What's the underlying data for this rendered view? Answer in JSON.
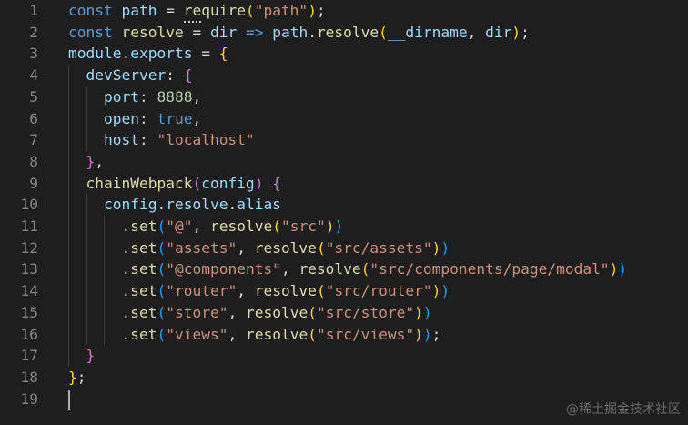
{
  "editor": {
    "line_numbers": [
      "1",
      "2",
      "3",
      "4",
      "5",
      "6",
      "7",
      "8",
      "9",
      "10",
      "11",
      "12",
      "13",
      "14",
      "15",
      "16",
      "17",
      "18",
      "19"
    ],
    "lines": [
      [
        {
          "t": "const ",
          "c": "kw"
        },
        {
          "t": "path",
          "c": "var"
        },
        {
          "t": " = ",
          "c": "op"
        },
        {
          "t": "require",
          "c": "fn"
        },
        {
          "t": "(",
          "c": "b1"
        },
        {
          "t": "\"path\"",
          "c": "str"
        },
        {
          "t": ")",
          "c": "b1"
        },
        {
          "t": ";",
          "c": "op"
        }
      ],
      [
        {
          "t": "const ",
          "c": "kw"
        },
        {
          "t": "resolve",
          "c": "fn"
        },
        {
          "t": " = ",
          "c": "op"
        },
        {
          "t": "dir",
          "c": "var"
        },
        {
          "t": " => ",
          "c": "kw"
        },
        {
          "t": "path",
          "c": "var"
        },
        {
          "t": ".",
          "c": "op"
        },
        {
          "t": "resolve",
          "c": "fn"
        },
        {
          "t": "(",
          "c": "b1"
        },
        {
          "t": "__dirname",
          "c": "var"
        },
        {
          "t": ", ",
          "c": "op"
        },
        {
          "t": "dir",
          "c": "var"
        },
        {
          "t": ")",
          "c": "b1"
        },
        {
          "t": ";",
          "c": "op"
        }
      ],
      [
        {
          "t": "module",
          "c": "var"
        },
        {
          "t": ".",
          "c": "op"
        },
        {
          "t": "exports",
          "c": "var"
        },
        {
          "t": " = ",
          "c": "op"
        },
        {
          "t": "{",
          "c": "b1"
        }
      ],
      [
        {
          "t": "  ",
          "c": "op"
        },
        {
          "t": "devServer",
          "c": "var"
        },
        {
          "t": ": ",
          "c": "op"
        },
        {
          "t": "{",
          "c": "b2"
        }
      ],
      [
        {
          "t": "    ",
          "c": "op"
        },
        {
          "t": "port",
          "c": "var"
        },
        {
          "t": ": ",
          "c": "op"
        },
        {
          "t": "8888",
          "c": "num"
        },
        {
          "t": ",",
          "c": "op"
        }
      ],
      [
        {
          "t": "    ",
          "c": "op"
        },
        {
          "t": "open",
          "c": "var"
        },
        {
          "t": ": ",
          "c": "op"
        },
        {
          "t": "true",
          "c": "kw"
        },
        {
          "t": ",",
          "c": "op"
        }
      ],
      [
        {
          "t": "    ",
          "c": "op"
        },
        {
          "t": "host",
          "c": "var"
        },
        {
          "t": ": ",
          "c": "op"
        },
        {
          "t": "\"localhost\"",
          "c": "str"
        }
      ],
      [
        {
          "t": "  ",
          "c": "op"
        },
        {
          "t": "}",
          "c": "b2"
        },
        {
          "t": ",",
          "c": "op"
        }
      ],
      [
        {
          "t": "  ",
          "c": "op"
        },
        {
          "t": "chainWebpack",
          "c": "fn"
        },
        {
          "t": "(",
          "c": "b2"
        },
        {
          "t": "config",
          "c": "var"
        },
        {
          "t": ")",
          "c": "b2"
        },
        {
          "t": " ",
          "c": "op"
        },
        {
          "t": "{",
          "c": "b2"
        }
      ],
      [
        {
          "t": "    ",
          "c": "op"
        },
        {
          "t": "config",
          "c": "var"
        },
        {
          "t": ".",
          "c": "op"
        },
        {
          "t": "resolve",
          "c": "var"
        },
        {
          "t": ".",
          "c": "op"
        },
        {
          "t": "alias",
          "c": "var"
        }
      ],
      [
        {
          "t": "      .",
          "c": "op"
        },
        {
          "t": "set",
          "c": "fn"
        },
        {
          "t": "(",
          "c": "b3"
        },
        {
          "t": "\"@\"",
          "c": "str"
        },
        {
          "t": ", ",
          "c": "op"
        },
        {
          "t": "resolve",
          "c": "fn"
        },
        {
          "t": "(",
          "c": "b1"
        },
        {
          "t": "\"src\"",
          "c": "str"
        },
        {
          "t": ")",
          "c": "b1"
        },
        {
          "t": ")",
          "c": "b3"
        }
      ],
      [
        {
          "t": "      .",
          "c": "op"
        },
        {
          "t": "set",
          "c": "fn"
        },
        {
          "t": "(",
          "c": "b3"
        },
        {
          "t": "\"assets\"",
          "c": "str"
        },
        {
          "t": ", ",
          "c": "op"
        },
        {
          "t": "resolve",
          "c": "fn"
        },
        {
          "t": "(",
          "c": "b1"
        },
        {
          "t": "\"src/assets\"",
          "c": "str"
        },
        {
          "t": ")",
          "c": "b1"
        },
        {
          "t": ")",
          "c": "b3"
        }
      ],
      [
        {
          "t": "      .",
          "c": "op"
        },
        {
          "t": "set",
          "c": "fn"
        },
        {
          "t": "(",
          "c": "b3"
        },
        {
          "t": "\"@components\"",
          "c": "str"
        },
        {
          "t": ", ",
          "c": "op"
        },
        {
          "t": "resolve",
          "c": "fn"
        },
        {
          "t": "(",
          "c": "b1"
        },
        {
          "t": "\"src/components/page/modal\"",
          "c": "str"
        },
        {
          "t": ")",
          "c": "b1"
        },
        {
          "t": ")",
          "c": "b3"
        }
      ],
      [
        {
          "t": "      .",
          "c": "op"
        },
        {
          "t": "set",
          "c": "fn"
        },
        {
          "t": "(",
          "c": "b3"
        },
        {
          "t": "\"router\"",
          "c": "str"
        },
        {
          "t": ", ",
          "c": "op"
        },
        {
          "t": "resolve",
          "c": "fn"
        },
        {
          "t": "(",
          "c": "b1"
        },
        {
          "t": "\"src/router\"",
          "c": "str"
        },
        {
          "t": ")",
          "c": "b1"
        },
        {
          "t": ")",
          "c": "b3"
        }
      ],
      [
        {
          "t": "      .",
          "c": "op"
        },
        {
          "t": "set",
          "c": "fn"
        },
        {
          "t": "(",
          "c": "b3"
        },
        {
          "t": "\"store\"",
          "c": "str"
        },
        {
          "t": ", ",
          "c": "op"
        },
        {
          "t": "resolve",
          "c": "fn"
        },
        {
          "t": "(",
          "c": "b1"
        },
        {
          "t": "\"src/store\"",
          "c": "str"
        },
        {
          "t": ")",
          "c": "b1"
        },
        {
          "t": ")",
          "c": "b3"
        }
      ],
      [
        {
          "t": "      .",
          "c": "op"
        },
        {
          "t": "set",
          "c": "fn"
        },
        {
          "t": "(",
          "c": "b3"
        },
        {
          "t": "\"views\"",
          "c": "str"
        },
        {
          "t": ", ",
          "c": "op"
        },
        {
          "t": "resolve",
          "c": "fn"
        },
        {
          "t": "(",
          "c": "b1"
        },
        {
          "t": "\"src/views\"",
          "c": "str"
        },
        {
          "t": ")",
          "c": "b1"
        },
        {
          "t": ")",
          "c": "b3"
        },
        {
          "t": ";",
          "c": "op"
        }
      ],
      [
        {
          "t": "  ",
          "c": "op"
        },
        {
          "t": "}",
          "c": "b2"
        }
      ],
      [
        {
          "t": "}",
          "c": "b1"
        },
        {
          "t": ";",
          "c": "op"
        }
      ],
      []
    ]
  },
  "colors": {
    "background": "#1e1e1e",
    "line_number": "#858585",
    "keyword": "#569cd6",
    "variable": "#9cdcfe",
    "function": "#dcdcaa",
    "string": "#ce9178",
    "number": "#b5cea8"
  },
  "watermark": "@稀土掘金技术社区"
}
